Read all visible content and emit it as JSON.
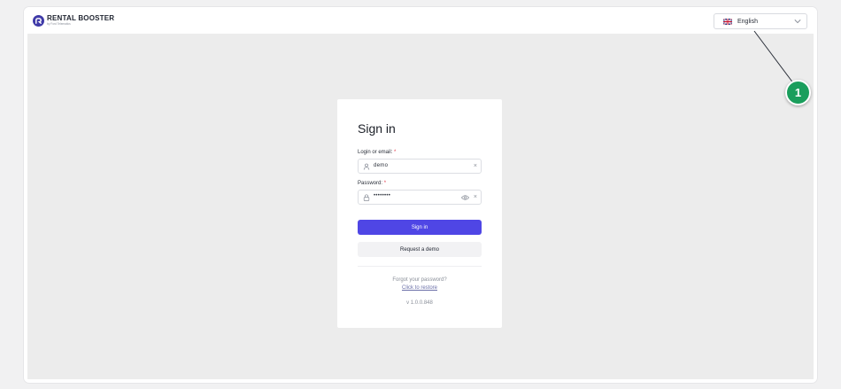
{
  "header": {
    "brand_name": "RENTAL BOOSTER",
    "brand_sub": "by Ford Telematics",
    "language": {
      "flag_icon": "uk-flag-icon",
      "selected": "English"
    }
  },
  "signin": {
    "title": "Sign in",
    "login_label": "Login or email:",
    "login_required": "*",
    "login_value": "demo",
    "password_label": "Password:",
    "password_required": "*",
    "password_value": "••••••••",
    "clear_glyph": "×",
    "signin_button": "Sign in",
    "request_demo_button": "Request a demo",
    "forgot_text": "Forgot your password?",
    "restore_link": "Click to restore",
    "version": "v 1.0.0.848"
  },
  "annotation": {
    "marker": "1"
  },
  "colors": {
    "primary": "#4f46e5",
    "badge": "#1a9e5c",
    "brand": "#3f3aa8",
    "required": "#e0394a"
  }
}
